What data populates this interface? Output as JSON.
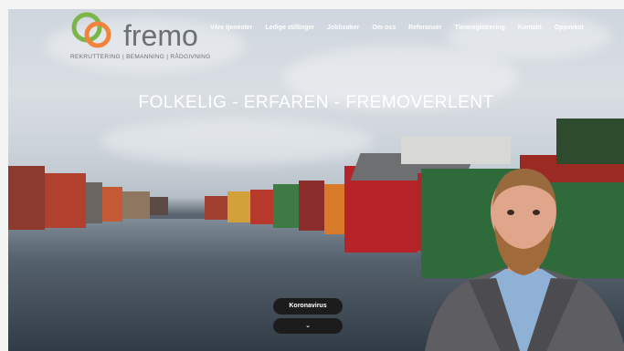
{
  "brand": {
    "name": "fremo",
    "tagline": "REKRUTTERING | BEMANNING | RÅDGIVNING",
    "colors": {
      "green": "#7ab648",
      "orange": "#f0843c",
      "text": "#6c6f73"
    }
  },
  "nav": {
    "items": [
      "Våre tjenester",
      "Ledige stillinger",
      "Jobbsøker",
      "Om oss",
      "Referanser",
      "Timeregistrering",
      "Kontakt",
      "Oppvekst"
    ]
  },
  "hero": {
    "headline": "FOLKELIG - ERFAREN - FREMOVERLENT"
  },
  "actions": {
    "corona_label": "Koronavirus",
    "expand_label": "⌄"
  }
}
